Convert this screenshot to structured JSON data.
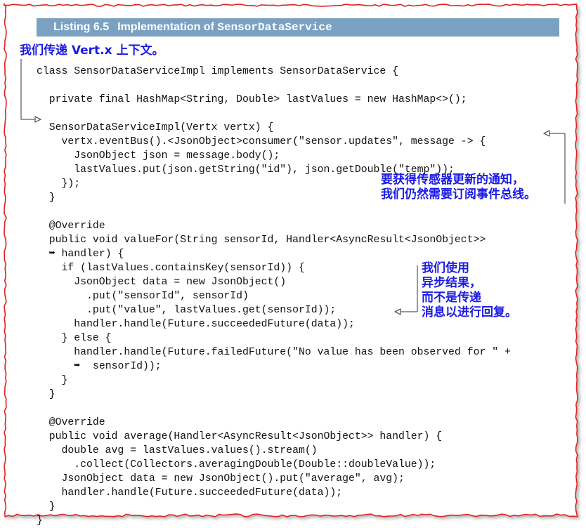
{
  "listing": {
    "number": "Listing 6.5",
    "title_prefix": "Implementation of ",
    "title_class": "SensorDataService"
  },
  "code_lines": [
    "class SensorDataServiceImpl implements SensorDataService {",
    "",
    "  private final HashMap<String, Double> lastValues = new HashMap<>();",
    "",
    "  SensorDataServiceImpl(Vertx vertx) {",
    "    vertx.eventBus().<JsonObject>consumer(\"sensor.updates\", message -> {",
    "      JsonObject json = message.body();",
    "      lastValues.put(json.getString(\"id\"), json.getDouble(\"temp\"));",
    "    });",
    "  }",
    "",
    "  @Override",
    "  public void valueFor(String sensorId, Handler<AsyncResult<JsonObject>>",
    "  ➥ handler) {",
    "    if (lastValues.containsKey(sensorId)) {",
    "      JsonObject data = new JsonObject()",
    "        .put(\"sensorId\", sensorId)",
    "        .put(\"value\", lastValues.get(sensorId));",
    "      handler.handle(Future.succeededFuture(data));",
    "    } else {",
    "      handler.handle(Future.failedFuture(\"No value has been observed for \" +",
    "      ➥  sensorId));",
    "    }",
    "  }",
    "",
    "  @Override",
    "  public void average(Handler<AsyncResult<JsonObject>> handler) {",
    "    double avg = lastValues.values().stream()",
    "      .collect(Collectors.averagingDouble(Double::doubleValue));",
    "    JsonObject data = new JsonObject().put(\"average\", avg);",
    "    handler.handle(Future.succeededFuture(data));",
    "  }",
    "}"
  ],
  "annotations": {
    "top": "我们传递 Vert.x 上下文。",
    "middle": [
      "要获得传感器更新的通知，",
      "我们仍然需要订阅事件总线。"
    ],
    "lower": [
      "我们使用",
      "异步结果，",
      "而不是传递",
      "消息以进行回复。"
    ]
  },
  "colors": {
    "header_bg": "#7ba1c2",
    "annotation": "#1a1ae6",
    "frame_border": "#e02020"
  }
}
